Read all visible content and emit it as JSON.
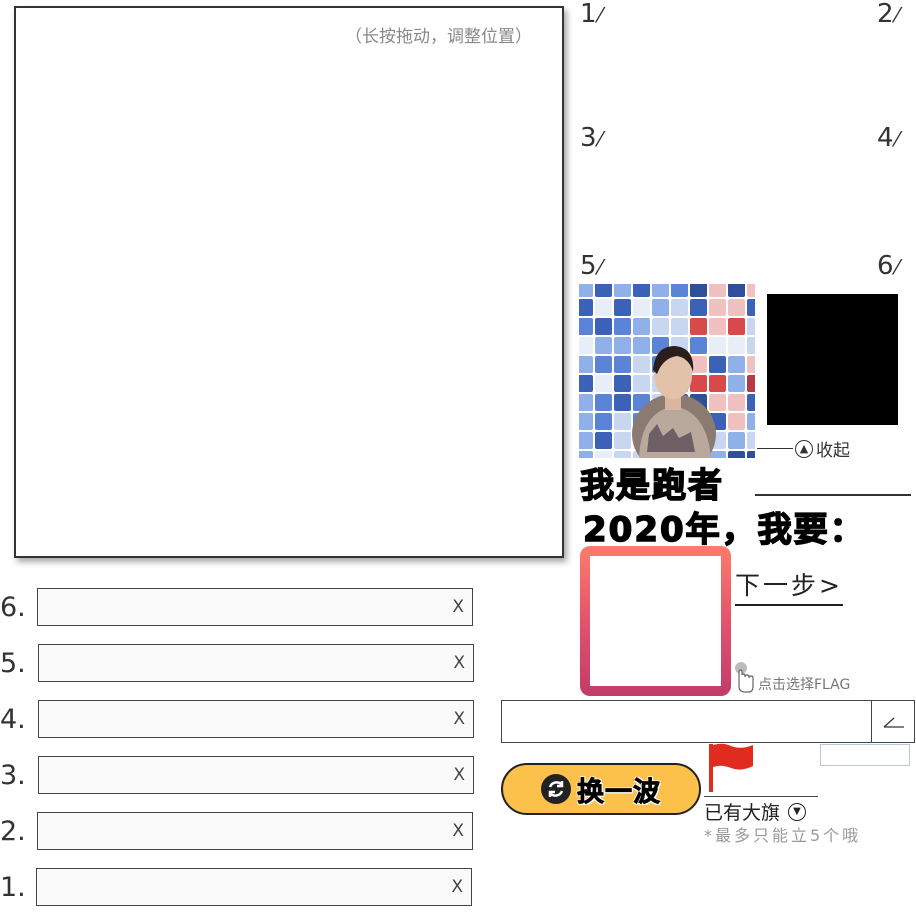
{
  "canvas": {
    "hint": "（长按拖动，调整位置）"
  },
  "slots": [
    "1",
    "2",
    "3",
    "4",
    "5",
    "6"
  ],
  "collapse_label": "收起",
  "title_line1": "我是跑者",
  "title_line2": "2020年，我要：",
  "next_step": "下一步>",
  "select_flag_hint": "点击选择FLAG",
  "flag_rows": [
    {
      "label": "6.",
      "value": "",
      "clear": "X"
    },
    {
      "label": "5.",
      "value": "",
      "clear": "X"
    },
    {
      "label": "4.",
      "value": "",
      "clear": "X"
    },
    {
      "label": "3.",
      "value": "",
      "clear": "X"
    },
    {
      "label": "2.",
      "value": "",
      "clear": "X"
    },
    {
      "label": "1.",
      "value": "",
      "clear": "X"
    }
  ],
  "flag_input": {
    "value": ""
  },
  "swap_button": "换一波",
  "existing_flags": "已有大旗",
  "limit_note": "*最多只能立5个哦",
  "colors": {
    "swap_bg": "#fcc14a",
    "card_gradient_top": "#ff7b6c",
    "card_gradient_bottom": "#c23b6a",
    "flag_red": "#e02b1f"
  }
}
